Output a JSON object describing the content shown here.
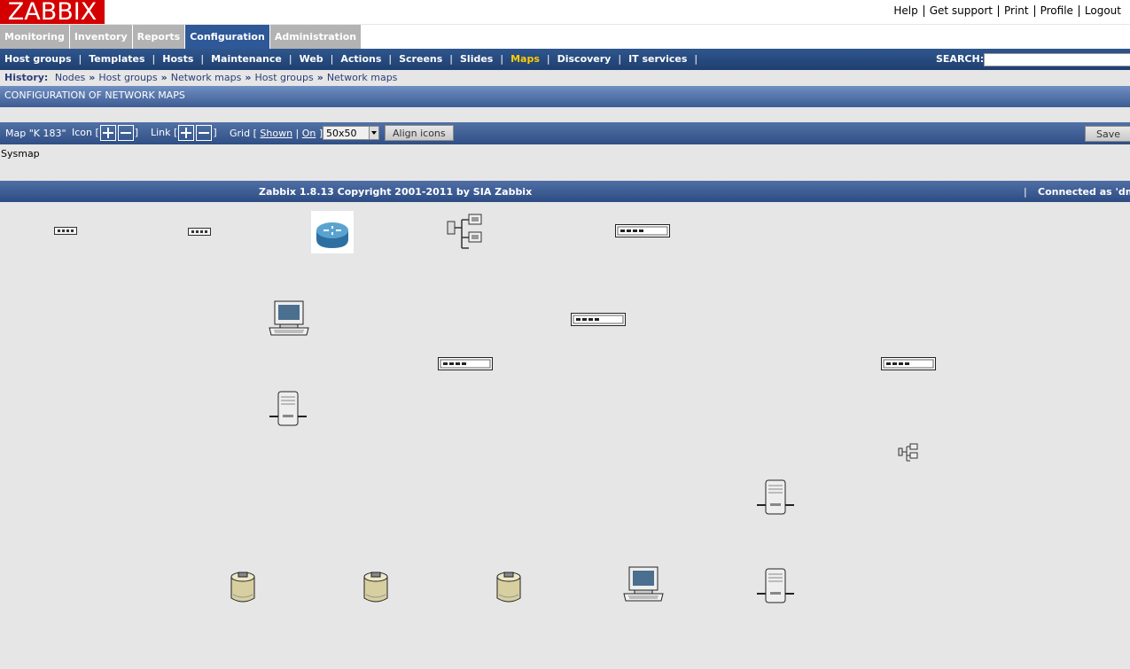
{
  "logo": "ZABBIX",
  "top_links": [
    "Help",
    "Get support",
    "Print",
    "Profile",
    "Logout"
  ],
  "main_tabs": [
    "Monitoring",
    "Inventory",
    "Reports",
    "Configuration",
    "Administration"
  ],
  "active_tab": "Configuration",
  "sub_menu": [
    "Host groups",
    "Templates",
    "Hosts",
    "Maintenance",
    "Web",
    "Actions",
    "Screens",
    "Slides",
    "Maps",
    "Discovery",
    "IT services"
  ],
  "selected_sub": "Maps",
  "search_label": "SEARCH:",
  "search_value": "",
  "history": {
    "label": "History:",
    "items": [
      "Nodes",
      "Host groups",
      "Network maps",
      "Host groups",
      "Network maps"
    ]
  },
  "section_title": "CONFIGURATION OF NETWORK MAPS",
  "toolbar": {
    "map_name": "Map \"K 183\"",
    "icon_label": "Icon",
    "link_label": "Link",
    "grid_label": "Grid",
    "grid_shown": "Shown",
    "grid_on": "On",
    "grid_size": "50x50",
    "align_label": "Align icons",
    "save_label": "Save"
  },
  "sysmap_label": "Sysmap",
  "footer": {
    "copyright": "Zabbix 1.8.13 Copyright 2001-2011 by SIA Zabbix",
    "connected": "Connected as 'dm'"
  },
  "map_elements": [
    "small-switch",
    "small-switch",
    "router",
    "network",
    "switch",
    "computer",
    "switch",
    "switch",
    "switch",
    "server",
    "network-small",
    "server",
    "disk",
    "disk",
    "disk",
    "computer",
    "server"
  ]
}
